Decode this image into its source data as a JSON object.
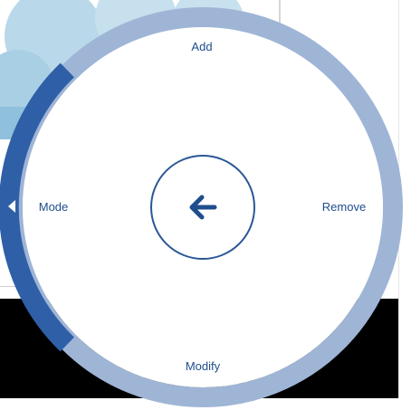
{
  "radial_menu": {
    "items": [
      {
        "id": "add",
        "label": "Add"
      },
      {
        "id": "remove",
        "label": "Remove"
      },
      {
        "id": "modify",
        "label": "Modify"
      },
      {
        "id": "mode",
        "label": "Mode",
        "selected": true
      }
    ],
    "center": {
      "icon": "back-arrow-icon"
    },
    "side_icon": "collapse-arrow-icon"
  },
  "colors": {
    "ring": "#9fb5d6",
    "ring_selected": "#2f5fa7",
    "label_text": "#1f4e8c",
    "center_border": "#2a5797",
    "arrow": "#1f4e8c",
    "background_blob": "#b9d9ea",
    "background_band": "#000000"
  }
}
